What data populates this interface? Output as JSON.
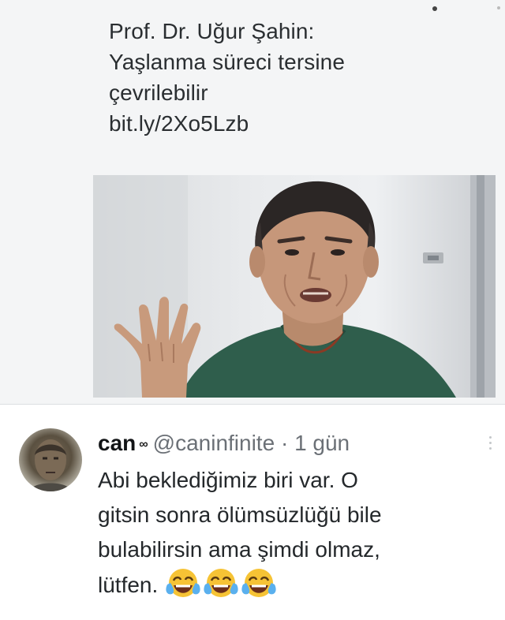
{
  "top_tweet": {
    "lines": [
      "Prof. Dr. Uğur Şahin:",
      "Yaşlanma süreci tersine",
      "çevrilebilir",
      "bit.ly/2Xo5Lzb"
    ]
  },
  "reply": {
    "name": "can",
    "badge": "∞",
    "handle": "@caninfinite",
    "separator": "·",
    "time": "1 gün",
    "body_lines": [
      "Abi beklediğimiz biri var. O",
      "gitsin sonra ölümsüzlüğü bile",
      "bulabilirsin ama şimdi olmaz,",
      "lütfen."
    ],
    "emoji": [
      "face-with-tears-of-joy",
      "face-with-tears-of-joy",
      "face-with-tears-of-joy"
    ]
  },
  "colors": {
    "top_background": "#f4f5f6",
    "reply_background": "#ffffff",
    "text": "#24282b",
    "muted_text": "#6b7076",
    "shirt_green": "#2f5e4c"
  }
}
